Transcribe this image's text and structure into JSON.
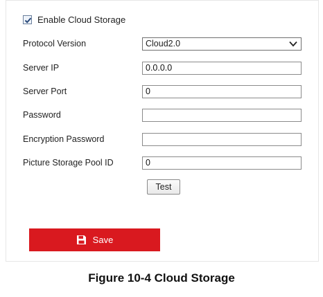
{
  "enable_cloud_storage": {
    "label": "Enable Cloud Storage",
    "checked": true
  },
  "fields": {
    "protocol_version": {
      "label": "Protocol Version",
      "value": "Cloud2.0"
    },
    "server_ip": {
      "label": "Server IP",
      "value": "0.0.0.0"
    },
    "server_port": {
      "label": "Server Port",
      "value": "0"
    },
    "password": {
      "label": "Password",
      "value": ""
    },
    "encryption_password": {
      "label": "Encryption Password",
      "value": ""
    },
    "picture_storage_pool_id": {
      "label": "Picture Storage Pool ID",
      "value": "0"
    }
  },
  "buttons": {
    "test_label": "Test",
    "save_label": "Save"
  },
  "icons": {
    "checkbox": "checkmark-icon",
    "dropdown": "chevron-down-icon",
    "save": "save-icon"
  },
  "colors": {
    "save_button": "#d9191f",
    "save_text": "#ffffff"
  },
  "caption": "Figure 10-4 Cloud Storage"
}
